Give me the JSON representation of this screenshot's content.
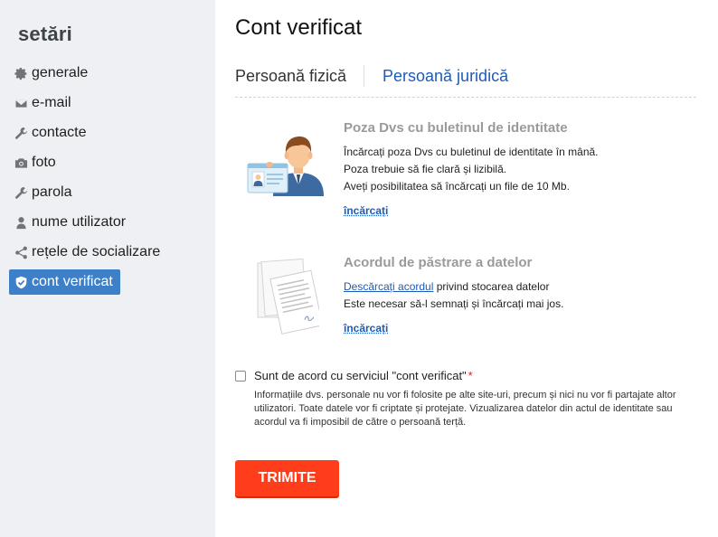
{
  "sidebar": {
    "title": "setări",
    "items": [
      {
        "label": "generale",
        "icon": "gear-icon"
      },
      {
        "label": "e-mail",
        "icon": "envelope-icon"
      },
      {
        "label": "contacte",
        "icon": "wrench-icon"
      },
      {
        "label": "foto",
        "icon": "camera-icon"
      },
      {
        "label": "parola",
        "icon": "key-icon"
      },
      {
        "label": "nume utilizator",
        "icon": "user-icon"
      },
      {
        "label": "rețele de socializare",
        "icon": "share-icon"
      },
      {
        "label": "cont verificat",
        "icon": "shield-check-icon",
        "active": true
      }
    ]
  },
  "main": {
    "title": "Cont verificat",
    "tabs": [
      {
        "label": "Persoană fizică"
      },
      {
        "label": "Persoană juridică",
        "active": true
      }
    ],
    "id_section": {
      "title": "Poza Dvs cu buletinul de identitate",
      "lines": [
        "Încărcați poza Dvs cu buletinul de identitate în mână.",
        "Poza trebuie să fie clară și lizibilă.",
        "Aveți posibilitatea să încărcați un file de 10 Mb."
      ],
      "upload_label": "încărcați"
    },
    "agreement_section": {
      "title": "Acordul de păstrare a datelor",
      "download_link": "Descărcați acordul",
      "download_rest": " privind stocarea datelor",
      "line2": "Este necesar să-l semnați și încărcați mai jos.",
      "upload_label": "încărcați"
    },
    "consent": {
      "label": "Sunt de acord cu serviciul \"cont verificat\"",
      "required_mark": "*",
      "note": "Informațiile dvs. personale nu vor fi folosite pe alte site-uri, precum și nici nu vor fi partajate altor utilizatori. Toate datele vor fi criptate și protejate. Vizualizarea datelor din actul de identitate sau acordul va fi imposibil de către o persoană terță."
    },
    "submit_label": "TRIMITE"
  },
  "colors": {
    "accent": "#3d80c8",
    "link": "#1e5bb8",
    "submit": "#ff3d1a",
    "sidebar_bg": "#eef0f3"
  }
}
